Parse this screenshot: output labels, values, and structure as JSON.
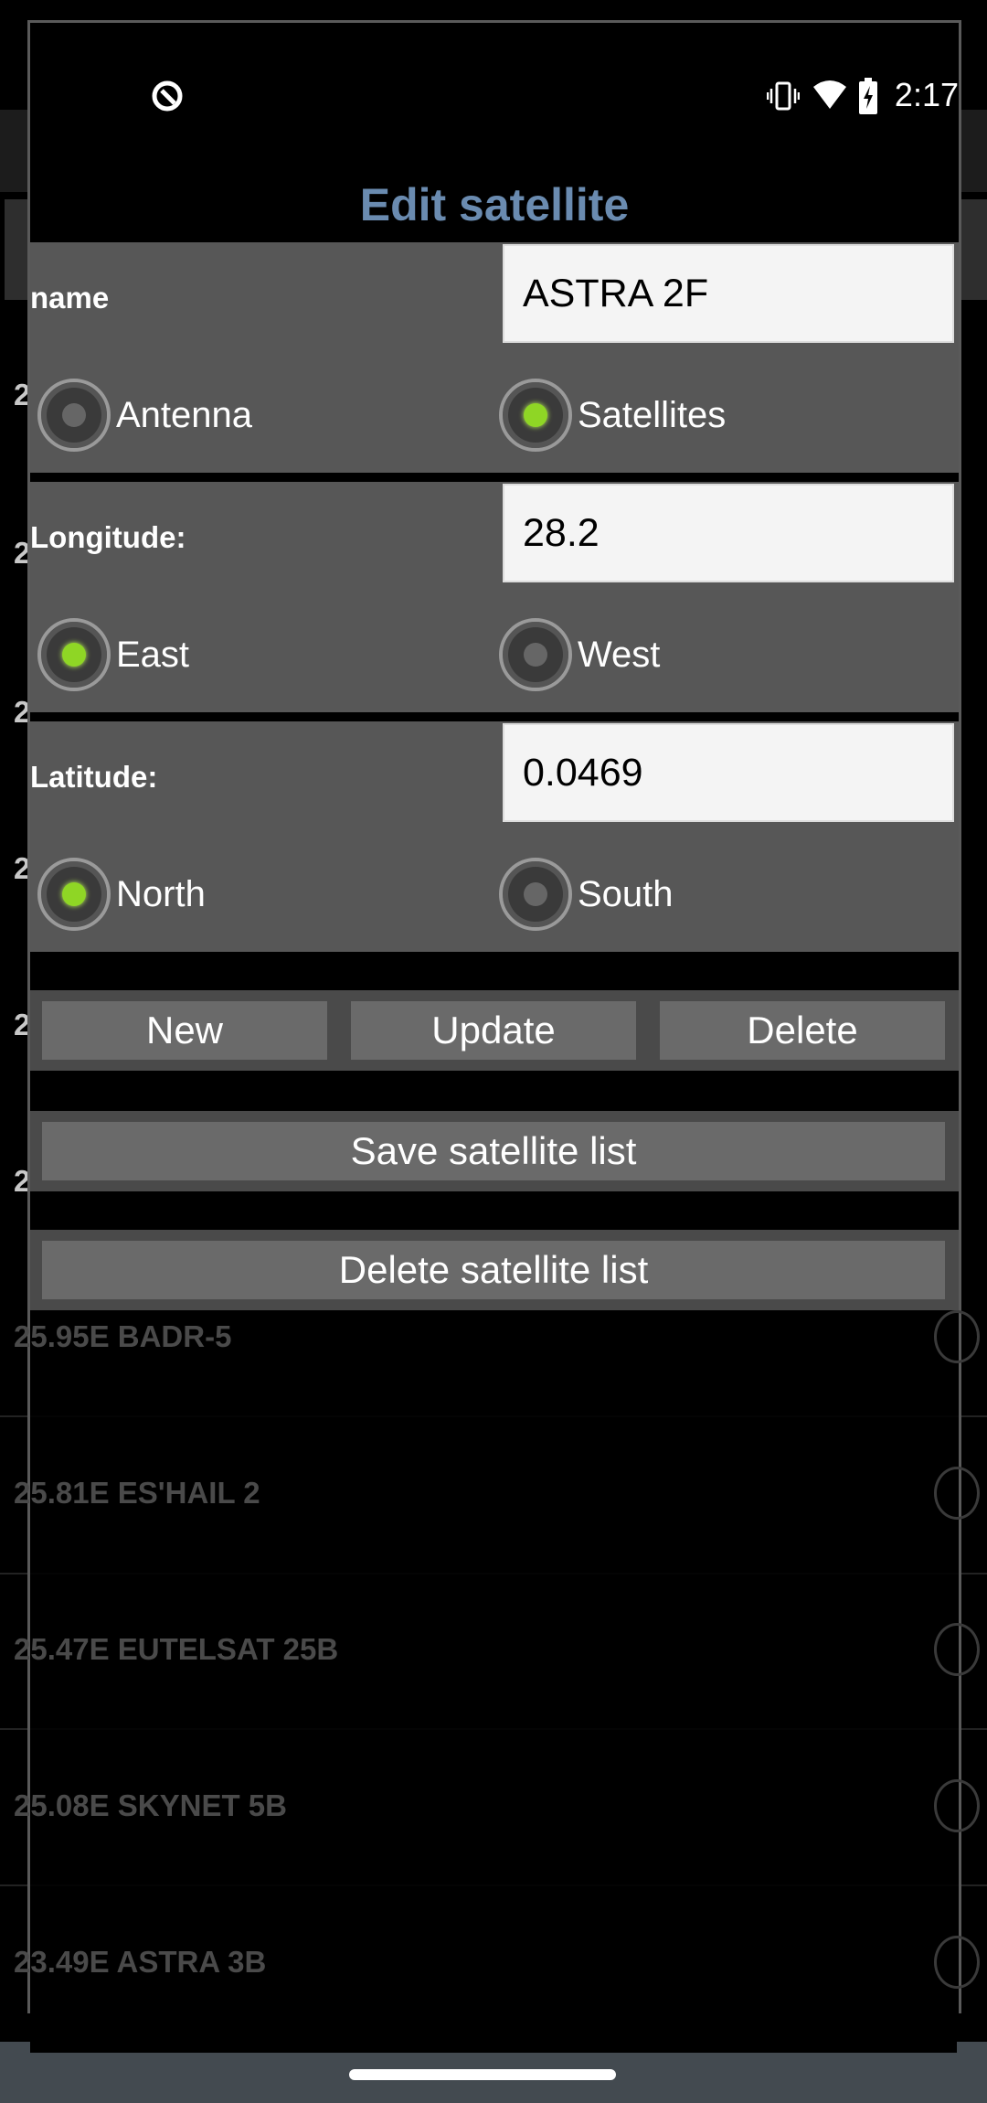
{
  "status_bar": {
    "time": "2:17",
    "icons": [
      "data-saver-icon",
      "vibrate-icon",
      "wifi-icon",
      "battery-charging-icon"
    ]
  },
  "background_list": {
    "partial_rows": [
      "2",
      "2",
      "2",
      "2",
      "2",
      "2"
    ],
    "rows": [
      "25.95E BADR-5",
      "25.81E ES'HAIL 2",
      "25.47E EUTELSAT 25B",
      "25.08E SKYNET 5B",
      "23.49E ASTRA 3B"
    ]
  },
  "dialog": {
    "title": "Edit satellite",
    "name": {
      "label": "name",
      "value": "ASTRA 2F",
      "options": [
        {
          "label": "Antenna",
          "checked": false
        },
        {
          "label": "Satellites",
          "checked": true
        }
      ]
    },
    "longitude": {
      "label": "Longitude:",
      "value": "28.2",
      "options": [
        {
          "label": "East",
          "checked": true
        },
        {
          "label": "West",
          "checked": false
        }
      ]
    },
    "latitude": {
      "label": "Latitude:",
      "value": "0.0469",
      "options": [
        {
          "label": "North",
          "checked": true
        },
        {
          "label": "South",
          "checked": false
        }
      ]
    },
    "buttons": {
      "new": "New",
      "update": "Update",
      "delete": "Delete",
      "save_list": "Save satellite list",
      "delete_list": "Delete satellite list"
    }
  },
  "colors": {
    "title": "#6a8bb0",
    "radio_on": "#8fd625",
    "panel": "#575757"
  }
}
